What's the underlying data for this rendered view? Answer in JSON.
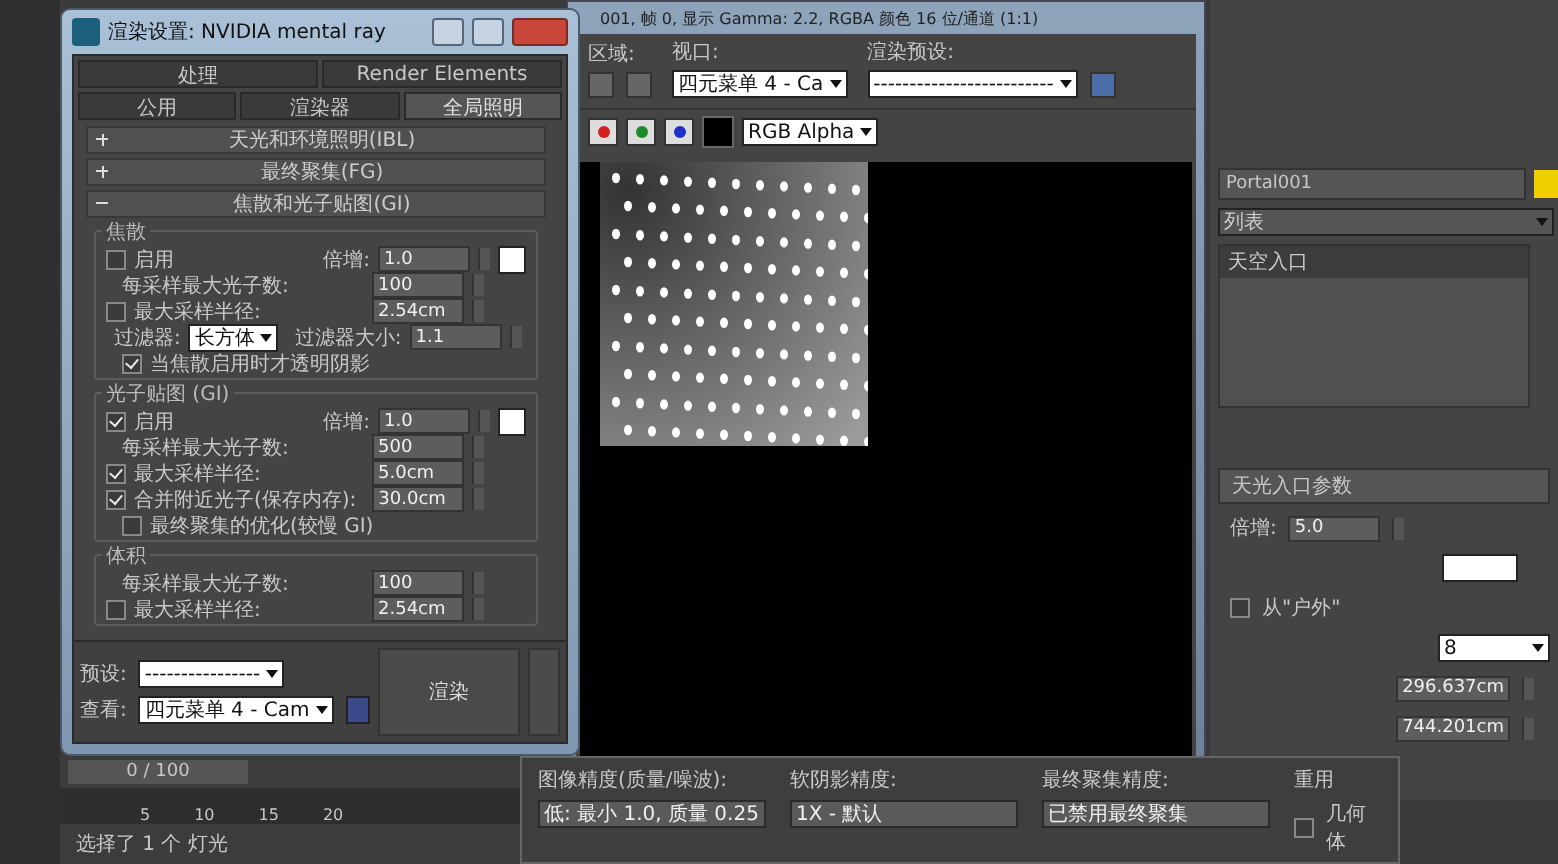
{
  "render_setup": {
    "title": "渲染设置: NVIDIA mental ray",
    "tabs": [
      [
        {
          "label": "处理",
          "selected": false
        },
        {
          "label": "Render Elements",
          "selected": false
        }
      ],
      [
        {
          "label": "公用",
          "selected": false
        },
        {
          "label": "渲染器",
          "selected": false
        },
        {
          "label": "全局照明",
          "selected": true
        }
      ]
    ],
    "rollouts": [
      {
        "label": "天光和环境照明(IBL)",
        "expanded": false
      },
      {
        "label": "最终聚集(FG)",
        "expanded": false
      },
      {
        "label": "焦散和光子贴图(GI)",
        "expanded": true
      }
    ],
    "groups": [
      {
        "title": "焦散",
        "rows": [
          {
            "kind": "enable",
            "label": "启用",
            "checked": false,
            "mult_label": "倍增:",
            "mult_value": "1.0"
          },
          {
            "kind": "number",
            "label": "每采样最大光子数:",
            "value": "100"
          },
          {
            "kind": "number",
            "label": "最大采样半径:",
            "checked": false,
            "value": "2.54cm"
          },
          {
            "kind": "filter",
            "label": "过滤器:",
            "value": "长方体",
            "size_label": "过滤器大小:",
            "size_value": "1.1"
          },
          {
            "kind": "check",
            "label": "当焦散启用时才透明阴影",
            "checked": true
          }
        ]
      },
      {
        "title": "光子贴图 (GI)",
        "rows": [
          {
            "kind": "enable",
            "label": "启用",
            "checked": true,
            "mult_label": "倍增:",
            "mult_value": "1.0"
          },
          {
            "kind": "number",
            "label": "每采样最大光子数:",
            "value": "500"
          },
          {
            "kind": "number",
            "label": "最大采样半径:",
            "checked": true,
            "value": "5.0cm"
          },
          {
            "kind": "number",
            "label": "合并附近光子(保存内存):",
            "checked": true,
            "value": "30.0cm"
          },
          {
            "kind": "check",
            "label": "最终聚集的优化(较慢 GI)",
            "checked": false
          }
        ]
      },
      {
        "title": "体积",
        "rows": [
          {
            "kind": "number",
            "label": "每采样最大光子数:",
            "value": "100"
          },
          {
            "kind": "number",
            "label": "最大采样半径:",
            "checked": false,
            "value": "2.54cm"
          }
        ]
      }
    ],
    "preset": {
      "label": "预设:",
      "value": "----------------"
    },
    "view": {
      "label": "查看:",
      "value": "四元菜单 4 - Cam"
    },
    "render_button": "渲染"
  },
  "frame_buffer": {
    "title": "001, 帧 0, 显示 Gamma: 2.2, RGBA 颜色 16 位/通道 (1:1)",
    "area_label": "区域:",
    "viewport_label": "视口:",
    "viewport_value": "四元菜单 4 - Ca",
    "preset_label": "渲染预设:",
    "preset_value": "-------------------------",
    "channels": [
      {
        "color": "#d42020"
      },
      {
        "color": "#1a8a2a"
      },
      {
        "color": "#2030c8"
      }
    ],
    "display_channel": "RGB Alpha",
    "settings": [
      {
        "label": "图像精度(质量/噪波):",
        "value": "低: 最小 1.0, 质量 0.25"
      },
      {
        "label": "软阴影精度:",
        "value": "1X - 默认"
      },
      {
        "label": "最终聚集精度:",
        "value": "已禁用最终聚集"
      }
    ],
    "reuse_label": "重用",
    "geometry": {
      "label": "几何体",
      "checked": false
    }
  },
  "command_panel": {
    "object_name": "Portal001",
    "modifier_list": "列表",
    "stack_item": "天空入口",
    "rollout": "天光入口参数",
    "multiplier_label": "倍增:",
    "multiplier_value": "5.0",
    "outdoor": {
      "label": "从\"户外\"",
      "checked": false
    },
    "dropdown_value": "8",
    "values": [
      "296.637cm",
      "744.201cm"
    ]
  },
  "timeline": {
    "counter": "0 / 100",
    "ticks": [
      "5",
      "10",
      "15",
      "20"
    ],
    "status": "选择了 1 个 灯光"
  }
}
